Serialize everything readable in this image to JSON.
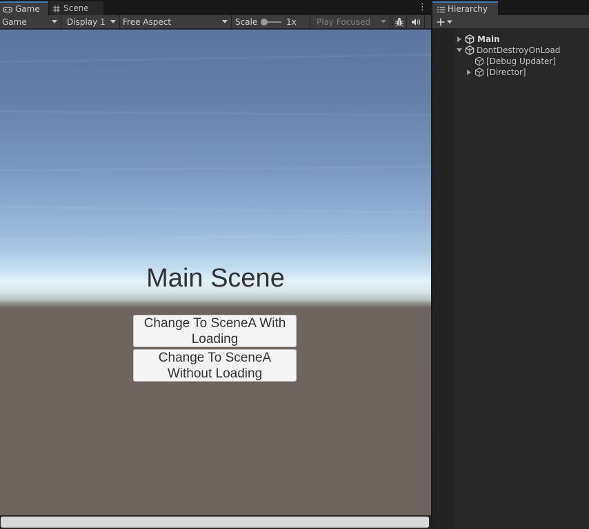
{
  "game_panel": {
    "tabs": [
      {
        "label": "Game",
        "icon": "gamepad-icon",
        "active": true
      },
      {
        "label": "Scene",
        "icon": "grid-icon",
        "active": false
      }
    ],
    "toolbar": {
      "game_mode": "Game",
      "display": "Display 1",
      "aspect": "Free Aspect",
      "scale_label": "Scale",
      "scale_value": "1x",
      "play_mode": "Play Focused",
      "icons": [
        "bug-icon",
        "audio-icon"
      ]
    },
    "viewport": {
      "title": "Main Scene",
      "buttons": [
        {
          "label": "Change To SceneA With Loading"
        },
        {
          "label": "Change To SceneA Without Loading"
        }
      ]
    }
  },
  "hierarchy_panel": {
    "tab": {
      "label": "Hierarchy",
      "icon": "list-icon"
    },
    "add_button_icon": "plus-icon",
    "items": [
      {
        "label": "Main",
        "icon": "unity-scene-icon",
        "expanded": false,
        "bold": true
      },
      {
        "label": "DontDestroyOnLoad",
        "icon": "unity-scene-icon",
        "expanded": true,
        "bold": false
      },
      {
        "label": "[Debug Updater]",
        "icon": "cube-icon",
        "expanded": null,
        "bold": false
      },
      {
        "label": "[Director]",
        "icon": "cube-icon",
        "expanded": false,
        "bold": false
      }
    ]
  },
  "colors": {
    "accent": "#3a79bb",
    "panel_bg": "#282828",
    "toolbar_bg": "#3c3c3c",
    "ground": "#6d625c",
    "sky_top": "#5a76a0",
    "button_bg": "#f4f4f4"
  }
}
